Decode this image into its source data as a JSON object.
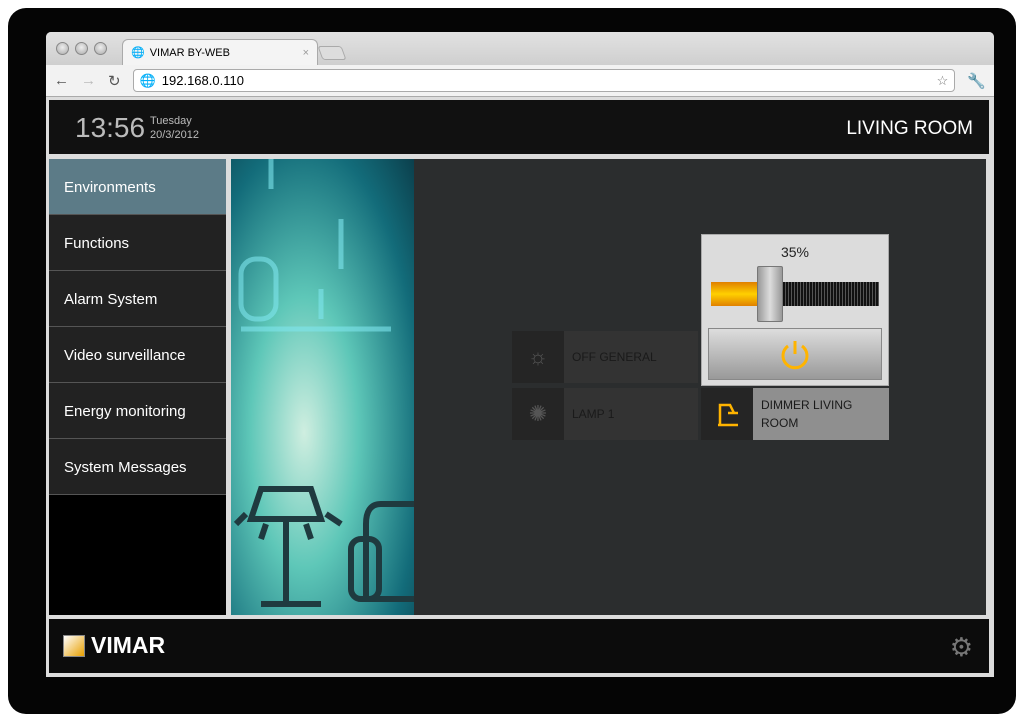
{
  "browser": {
    "tab_title": "VIMAR BY-WEB",
    "url": "192.168.0.110"
  },
  "header": {
    "time": "13:56",
    "weekday": "Tuesday",
    "date": "20/3/2012",
    "room": "LIVING ROOM"
  },
  "sidebar": {
    "items": [
      {
        "label": "Environments",
        "active": true
      },
      {
        "label": "Functions"
      },
      {
        "label": "Alarm System"
      },
      {
        "label": "Video surveillance"
      },
      {
        "label": "Energy monitoring"
      },
      {
        "label": "System Messages"
      }
    ]
  },
  "devices": {
    "off_general": "OFF GENERAL",
    "lamp1": "LAMP 1",
    "dimmer_line1": "DIMMER LIVING",
    "dimmer_line2": "ROOM"
  },
  "dimmer": {
    "level_label": "35%",
    "level": 35,
    "accent": "#ffb400"
  },
  "footer": {
    "brand": "VIMAR"
  }
}
